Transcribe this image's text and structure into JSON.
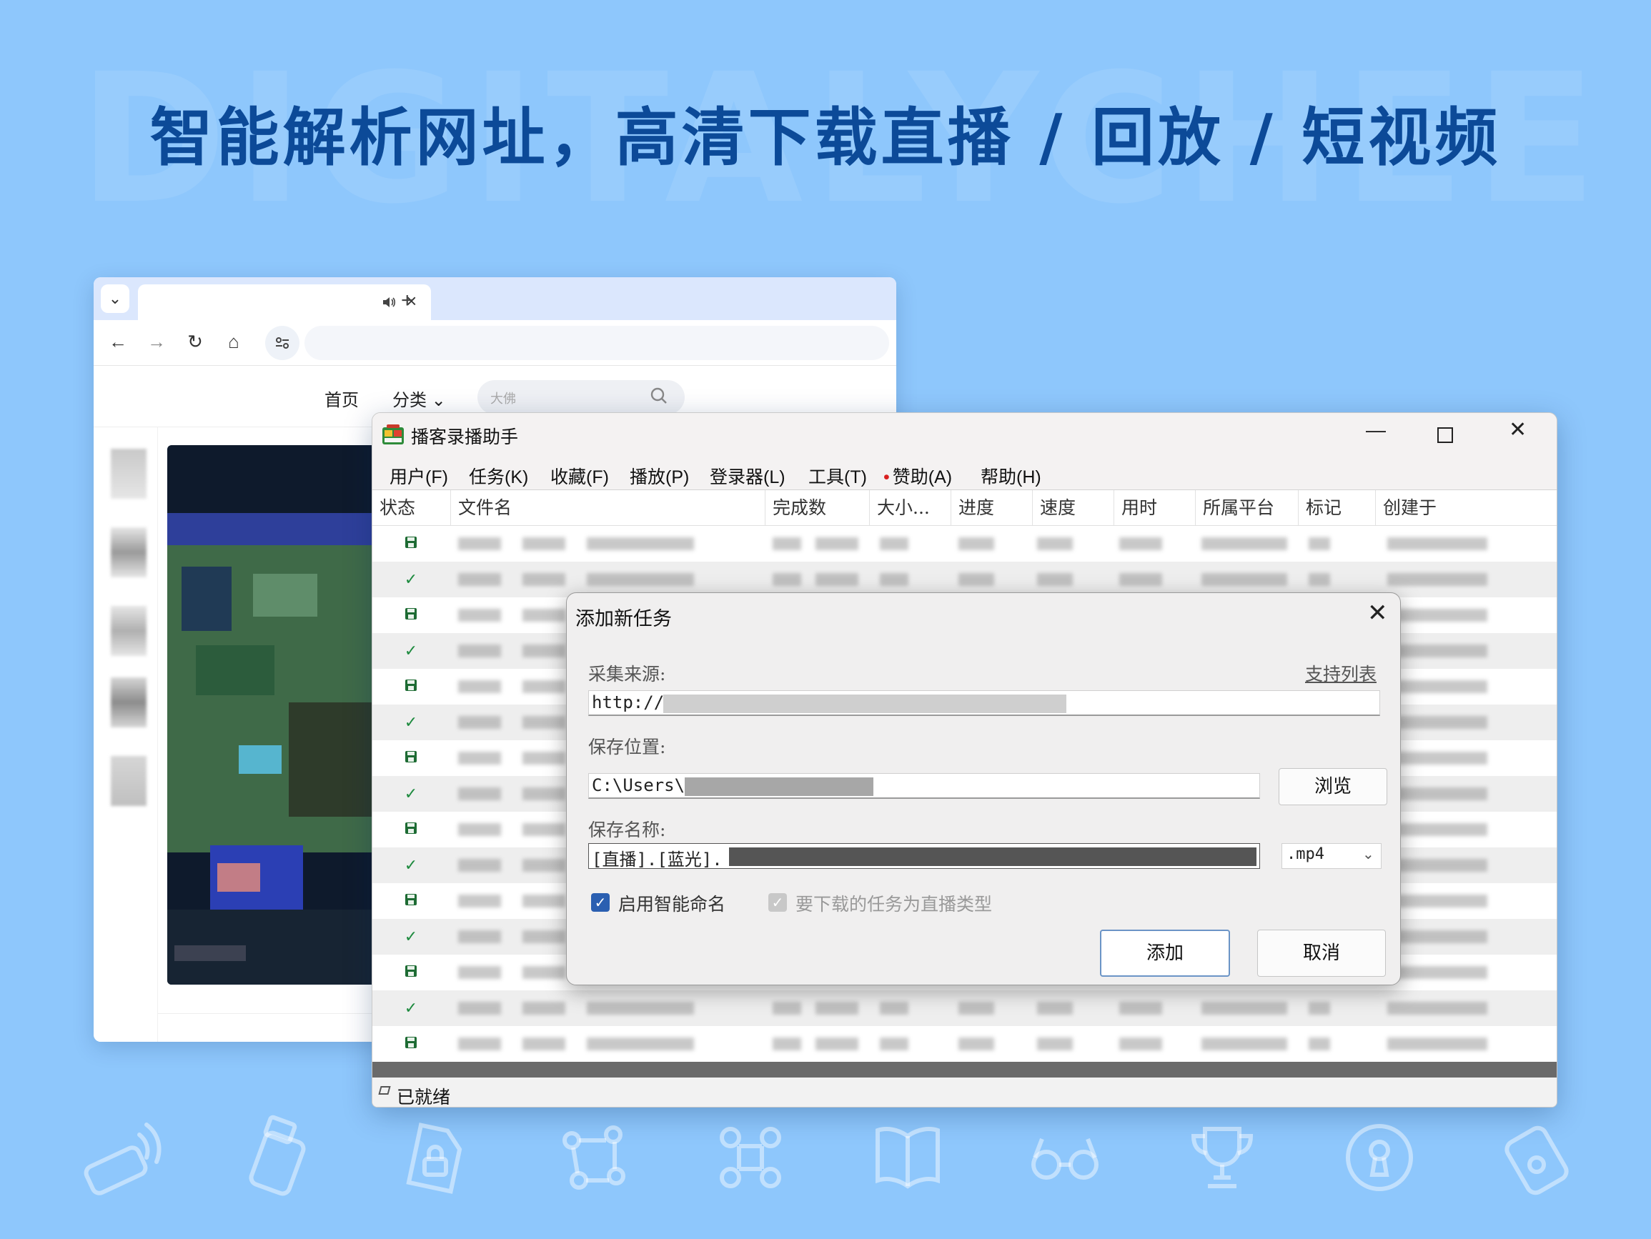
{
  "headline": {
    "watermark": "DIGITALYCHEE",
    "title": "智能解析网址，高清下载直播 / 回放 / 短视频"
  },
  "browser": {
    "tab_close": "×",
    "new_tab": "+",
    "nav": {
      "back": "←",
      "forward": "→",
      "reload": "↻",
      "home": "⌂"
    },
    "site_nav": {
      "home": "首页",
      "category": "分类 ⌄",
      "search_placeholder": "大佛"
    }
  },
  "app": {
    "title": "播客录播助手",
    "window_controls": {
      "minimize": "—",
      "close": "✕"
    },
    "menu": [
      {
        "label": "用户(F)"
      },
      {
        "label": "任务(K)"
      },
      {
        "label": "收藏(F)"
      },
      {
        "label": "播放(P)"
      },
      {
        "label": "登录器(L)"
      },
      {
        "label": "工具(T)"
      },
      {
        "label": "赞助(A)",
        "dot": "•"
      },
      {
        "label": "帮助(H)"
      }
    ],
    "columns": [
      "状态",
      "文件名",
      "完成数",
      "大小...",
      "进度",
      "速度",
      "用时",
      "所属平台",
      "标记",
      "创建于"
    ],
    "rows": [
      {
        "status": "save-icon"
      },
      {
        "status": "check-icon"
      },
      {
        "status": "save-icon"
      },
      {
        "status": "check-icon"
      },
      {
        "status": "save-icon"
      },
      {
        "status": "check-icon"
      },
      {
        "status": "save-icon"
      },
      {
        "status": "check-icon"
      },
      {
        "status": "save-icon"
      },
      {
        "status": "check-icon"
      },
      {
        "status": "save-icon"
      },
      {
        "status": "check-icon"
      },
      {
        "status": "save-icon"
      },
      {
        "status": "check-icon"
      },
      {
        "status": "save-icon"
      }
    ],
    "status_bar": "已就绪"
  },
  "dialog": {
    "title": "添加新任务",
    "close": "✕",
    "source_label": "采集来源:",
    "support_link": "支持列表",
    "source_value": "http://",
    "location_label": "保存位置:",
    "location_value": "C:\\Users\\",
    "browse_button": "浏览",
    "name_label": "保存名称:",
    "name_value": "[直播].[蓝光].",
    "format_value": ".mp4",
    "smart_naming": {
      "label": "启用智能命名",
      "checked": true
    },
    "live_type": {
      "label": "要下载的任务为直播类型",
      "checked": true,
      "enabled": false
    },
    "add_button": "添加",
    "cancel_button": "取消"
  },
  "colors": {
    "background": "#8ec7fc",
    "headline": "#0c4a98",
    "checkbox": "#2b5fb1",
    "row_alt": "#eeeeee"
  }
}
